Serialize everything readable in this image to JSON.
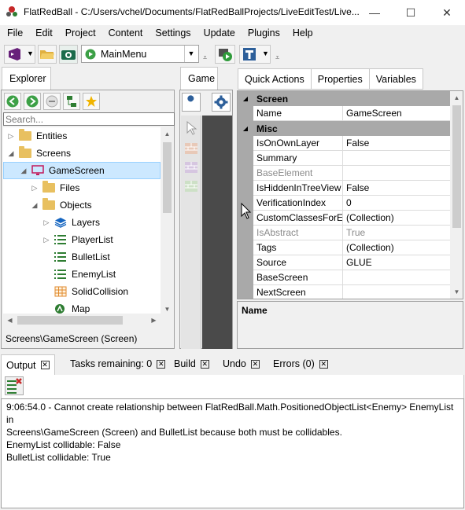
{
  "window": {
    "title": "FlatRedBall - C:/Users/vchel/Documents/FlatRedBallProjects/LiveEditTest/Live...",
    "minimize": "—",
    "maximize": "☐",
    "close": "✕"
  },
  "menu": [
    "File",
    "Edit",
    "Project",
    "Content",
    "Settings",
    "Update",
    "Plugins",
    "Help"
  ],
  "toolbar": {
    "screen_select": "MainMenu"
  },
  "explorer": {
    "tab": "Explorer",
    "search_placeholder": "Search...",
    "tree": [
      {
        "label": "Entities",
        "depth": 0,
        "expander": "›",
        "icon": "folder"
      },
      {
        "label": "Screens",
        "depth": 0,
        "expander": "⌄",
        "icon": "folder"
      },
      {
        "label": "GameScreen",
        "depth": 1,
        "expander": "⌄",
        "icon": "screen",
        "selected": true
      },
      {
        "label": "Files",
        "depth": 2,
        "expander": "›",
        "icon": "folder"
      },
      {
        "label": "Objects",
        "depth": 2,
        "expander": "⌄",
        "icon": "folder"
      },
      {
        "label": "Layers",
        "depth": 3,
        "expander": "›",
        "icon": "layers"
      },
      {
        "label": "PlayerList",
        "depth": 3,
        "expander": "›",
        "icon": "list"
      },
      {
        "label": "BulletList",
        "depth": 3,
        "expander": "",
        "icon": "list"
      },
      {
        "label": "EnemyList",
        "depth": 3,
        "expander": "",
        "icon": "list"
      },
      {
        "label": "SolidCollision",
        "depth": 3,
        "expander": "",
        "icon": "grid"
      },
      {
        "label": "Map",
        "depth": 3,
        "expander": "",
        "icon": "map"
      }
    ],
    "status": "Screens\\GameScreen (Screen)"
  },
  "game_tab": "Game",
  "right_tabs": [
    "Quick Actions",
    "Properties",
    "Variables"
  ],
  "propgrid": {
    "categories": [
      {
        "name": "Screen",
        "rows": [
          {
            "name": "Name",
            "value": "GameScreen",
            "gray": false
          }
        ]
      },
      {
        "name": "Misc",
        "rows": [
          {
            "name": "IsOnOwnLayer",
            "value": "False",
            "gray": false
          },
          {
            "name": "Summary",
            "value": "",
            "gray": false
          },
          {
            "name": "BaseElement",
            "value": "",
            "gray": true
          },
          {
            "name": "IsHiddenInTreeView",
            "value": "False",
            "gray": false
          },
          {
            "name": "VerificationIndex",
            "value": "0",
            "gray": false
          },
          {
            "name": "CustomClassesForEx",
            "value": "(Collection)",
            "gray": false
          },
          {
            "name": "IsAbstract",
            "value": "True",
            "gray": true
          },
          {
            "name": "Tags",
            "value": "(Collection)",
            "gray": false
          },
          {
            "name": "Source",
            "value": "GLUE",
            "gray": false
          },
          {
            "name": "BaseScreen",
            "value": "",
            "gray": false
          },
          {
            "name": "NextScreen",
            "value": "",
            "gray": false
          }
        ]
      }
    ],
    "description_title": "Name"
  },
  "bottom_tabs": [
    {
      "label": "Output",
      "close": "✕"
    },
    {
      "label": "Tasks remaining: 0",
      "close": "✕"
    },
    {
      "label": "Build",
      "close": "✕"
    },
    {
      "label": "Undo",
      "close": "✕"
    },
    {
      "label": "Errors (0)",
      "close": "✕"
    }
  ],
  "output_lines": [
    "9:06:54.0 - Cannot create relationship between FlatRedBall.Math.PositionedObjectList<Enemy> EnemyList in",
    "Screens\\GameScreen (Screen) and BulletList because both must be collidables.",
    "EnemyList collidable: False",
    "BulletList collidable: True"
  ],
  "colors": {
    "selection": "#cce8ff",
    "category": "#a9a9a9",
    "game_dark": "#4a4a4a",
    "accent_green": "#2e7d32"
  }
}
